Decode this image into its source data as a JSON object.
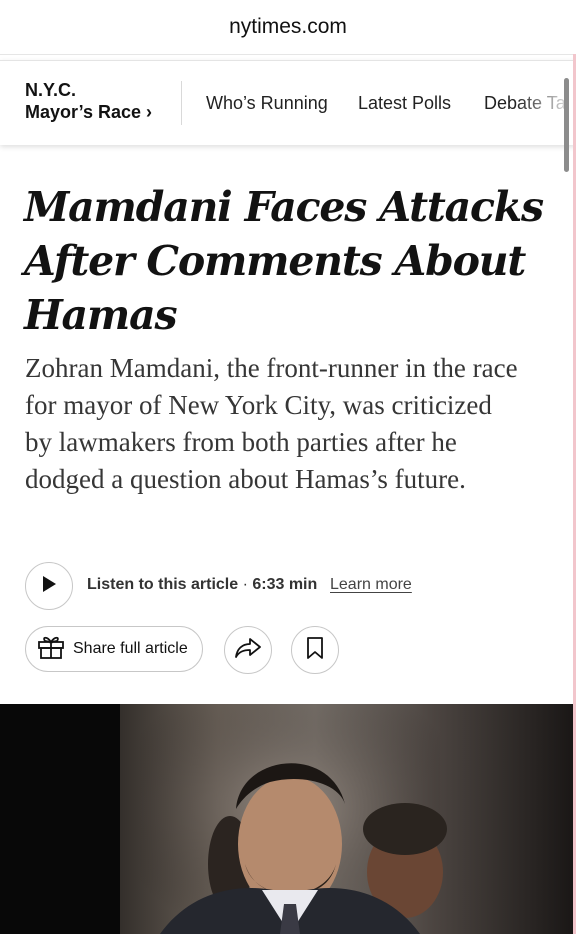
{
  "browser": {
    "url": "nytimes.com"
  },
  "section_nav": {
    "section_line1": "N.Y.C.",
    "section_line2": "Mayor’s Race ›",
    "links": [
      "Who’s Running",
      "Latest Polls",
      "Debate Ta"
    ]
  },
  "article": {
    "headline": "Mamdani Faces Attacks After Comments About Hamas",
    "summary": "Zohran Mamdani, the front-runner in the race for mayor of New York City, was criticized by lawmakers from both parties after he dodged a question about Hamas’s future.",
    "listen": {
      "label": "Listen to this article",
      "separator": " · ",
      "duration": "6:33 min",
      "learn_more": "Learn more"
    },
    "share_label": "Share full article"
  },
  "colors": {
    "text": "#121212",
    "summary_text": "#363636",
    "border": "#c7c7c7"
  },
  "icons": [
    "play-icon",
    "gift-icon",
    "share-arrow-icon",
    "bookmark-icon"
  ]
}
